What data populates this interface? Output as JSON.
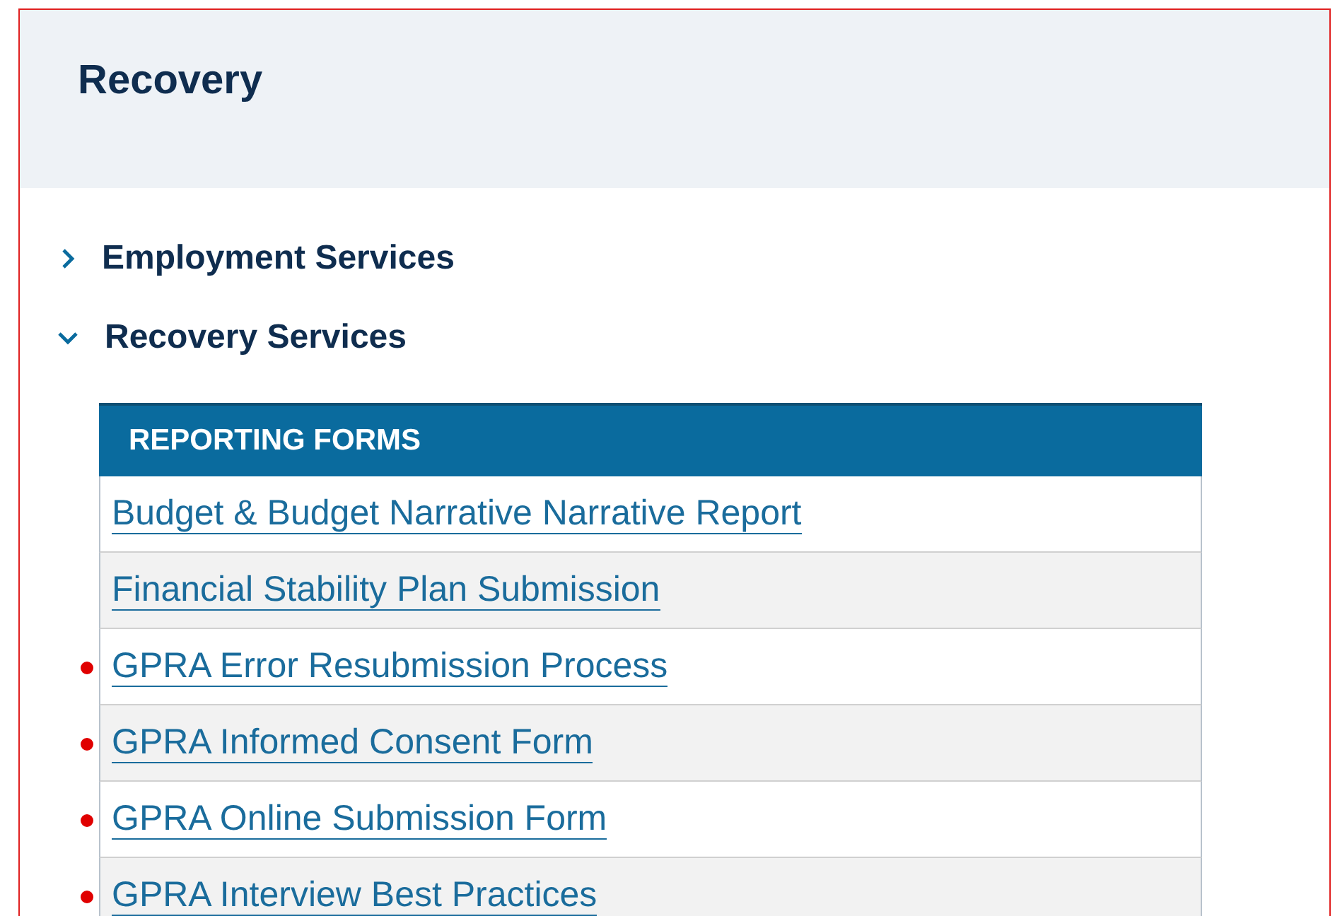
{
  "header": {
    "title": "Recovery"
  },
  "sections": [
    {
      "label": "Employment Services",
      "expanded": false
    },
    {
      "label": "Recovery Services",
      "expanded": true
    }
  ],
  "table": {
    "heading": "REPORTING FORMS",
    "rows": [
      {
        "label": "Budget & Budget Narrative Narrative Report",
        "bulleted": false
      },
      {
        "label": "Financial Stability Plan Submission",
        "bulleted": false
      },
      {
        "label": "GPRA Error Resubmission Process",
        "bulleted": true
      },
      {
        "label": "GPRA Informed Consent Form",
        "bulleted": true
      },
      {
        "label": "GPRA Online Submission Form",
        "bulleted": true
      },
      {
        "label": "GPRA Interview Best Practices",
        "bulleted": true
      }
    ]
  }
}
